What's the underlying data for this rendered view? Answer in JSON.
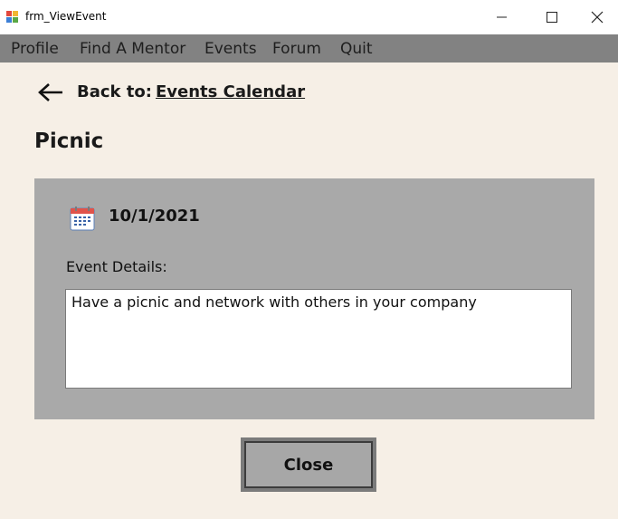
{
  "window": {
    "title": "frm_ViewEvent",
    "icons": {
      "app": "app-window-icon",
      "minimize": "minimize-icon",
      "maximize": "maximize-icon",
      "close": "close-icon"
    }
  },
  "menu": {
    "items": [
      {
        "label": "Profile"
      },
      {
        "label": "Find A Mentor"
      },
      {
        "label": "Events"
      },
      {
        "label": "Forum"
      },
      {
        "label": "Quit"
      }
    ]
  },
  "nav": {
    "back_icon": "arrow-left-icon",
    "back_label": "Back to:",
    "back_link": "Events Calendar"
  },
  "event": {
    "title": "Picnic",
    "date_icon": "calendar-icon",
    "date": "10/1/2021",
    "details_label": "Event Details:",
    "details": "Have a picnic and network with others in your company"
  },
  "actions": {
    "close_label": "Close"
  },
  "colors": {
    "background": "#f6efe6",
    "menubar": "#828282",
    "panel": "#a9a9a9",
    "button": "#a7a7a7"
  }
}
